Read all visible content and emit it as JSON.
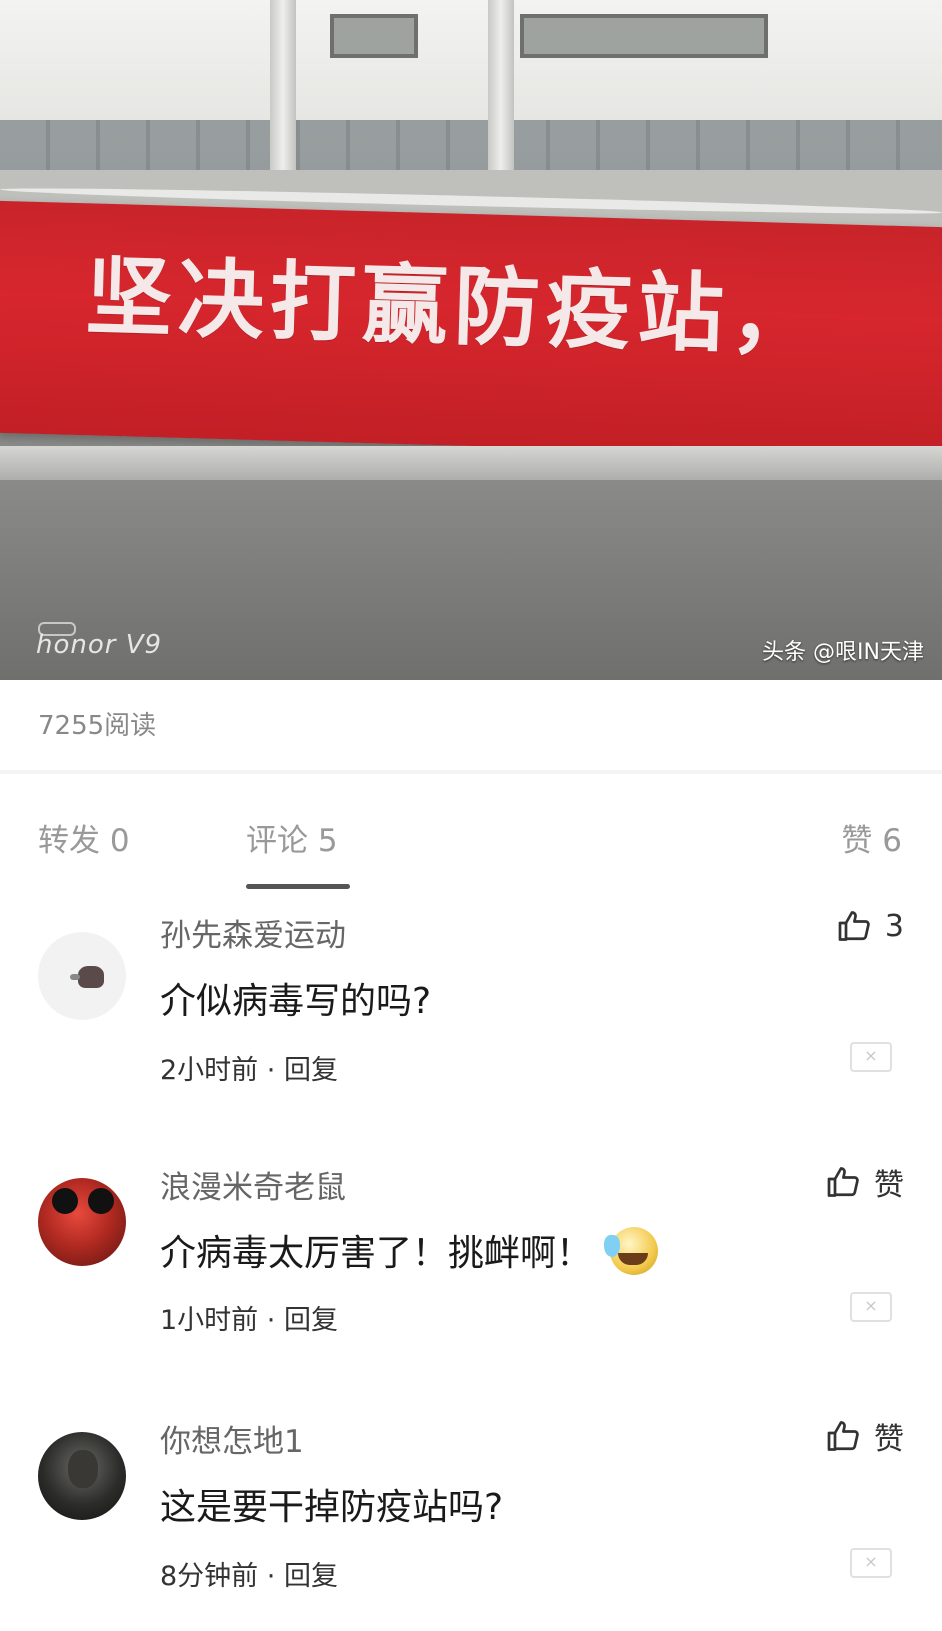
{
  "photo": {
    "banner_text": "坚决打赢防疫站，",
    "camera_mark": "honor V9",
    "watermark": "头条 @哏IN天津"
  },
  "stats": {
    "reads": "7255阅读"
  },
  "tabs": [
    {
      "label": "转发 0"
    },
    {
      "label": "评论 5"
    },
    {
      "label": "赞 6"
    }
  ],
  "comments": [
    {
      "user": "孙先森爱运动",
      "text": "介似病毒写的吗?",
      "time": "2小时前",
      "reply": "回复",
      "like": "3",
      "close": "×"
    },
    {
      "user": "浪漫米奇老鼠",
      "text": "介病毒太厉害了！挑衅啊！",
      "time": "1小时前",
      "reply": "回复",
      "like": "赞",
      "close": "×"
    },
    {
      "user": "你想怎地1",
      "text": "这是要干掉防疫站吗?",
      "time": "8分钟前",
      "reply": "回复",
      "like": "赞",
      "close": "×"
    }
  ]
}
